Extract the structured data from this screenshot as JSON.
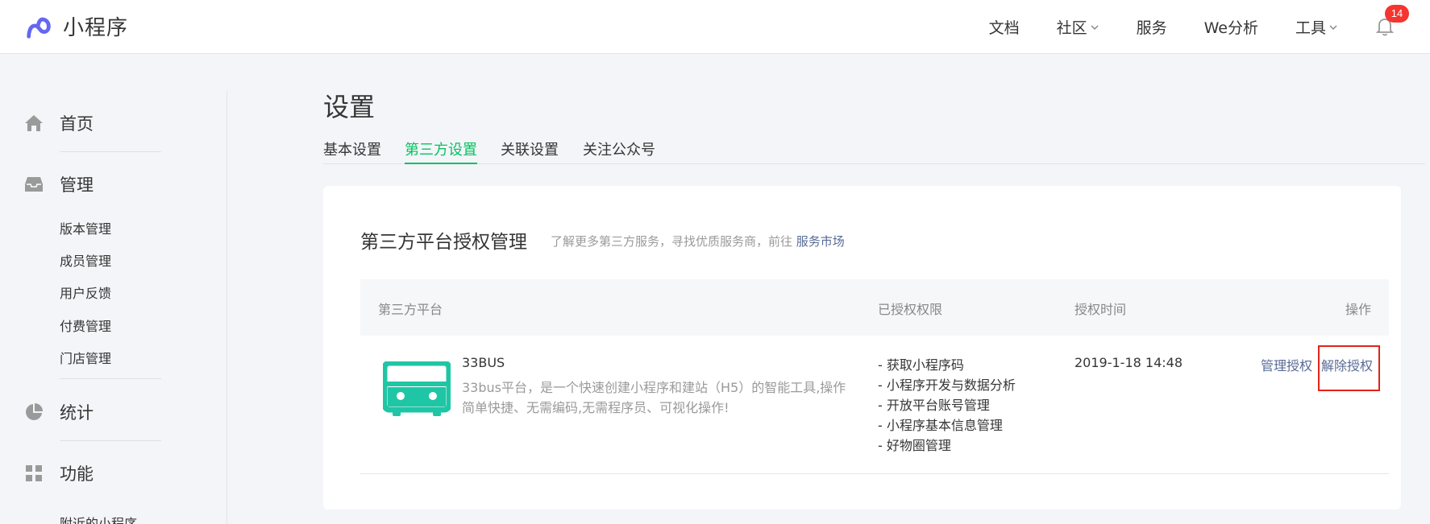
{
  "header": {
    "logo_text": "小程序",
    "nav": [
      "文档",
      "社区",
      "服务",
      "We分析",
      "工具"
    ],
    "notification_count": "14"
  },
  "sidebar": {
    "groups": [
      {
        "label": "首页",
        "icon": "home-icon"
      },
      {
        "label": "管理",
        "icon": "inbox-icon"
      },
      {
        "label": "统计",
        "icon": "pie-chart-icon"
      },
      {
        "label": "功能",
        "icon": "grid-icon"
      }
    ],
    "manage_items": [
      "版本管理",
      "成员管理",
      "用户反馈",
      "付费管理",
      "门店管理"
    ],
    "feature_items": [
      "附近的小程序"
    ]
  },
  "main": {
    "title": "设置",
    "tabs": [
      "基本设置",
      "第三方设置",
      "关联设置",
      "关注公众号"
    ],
    "active_tab": 1
  },
  "card": {
    "title": "第三方平台授权管理",
    "tip": "了解更多第三方服务，寻找优质服务商，前往",
    "tip_link": "服务市场",
    "columns": [
      "第三方平台",
      "已授权权限",
      "授权时间",
      "操作"
    ],
    "row": {
      "name": "33BUS",
      "desc": "33bus平台，是一个快速创建小程序和建站（H5）的智能工具,操作简单快捷、无需编码,无需程序员、可视化操作!",
      "permissions": [
        "- 获取小程序码",
        "- 小程序开发与数据分析",
        "- 开放平台账号管理",
        "- 小程序基本信息管理",
        "- 好物圈管理"
      ],
      "time": "2019-1-18 14:48",
      "manage_label": "管理授权",
      "revoke_label": "解除授权"
    }
  },
  "colors": {
    "accent": "#07c160",
    "link": "#576b95",
    "badge": "#f43530",
    "bus_icon": "#1fc6a5",
    "highlight": "#e2231a"
  }
}
